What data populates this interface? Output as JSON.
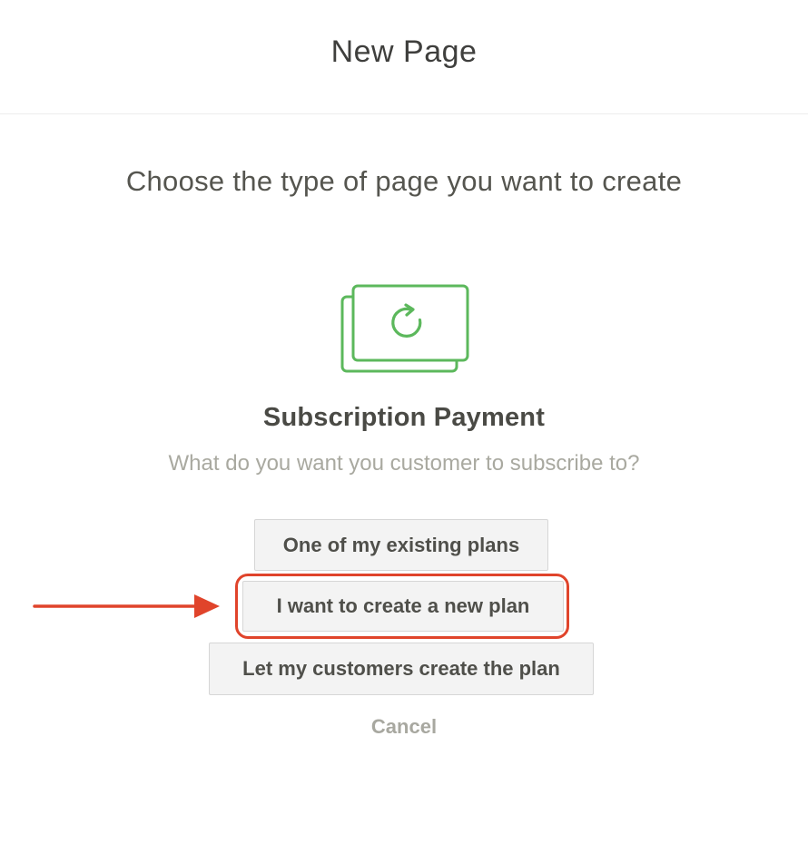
{
  "header": {
    "title": "New Page"
  },
  "main": {
    "prompt": "Choose the type of page you want to create",
    "type_title": "Subscription Payment",
    "question": "What do you want you customer to subscribe to?",
    "options": [
      {
        "label": "One of my existing plans"
      },
      {
        "label": "I want to create a new plan",
        "highlighted": true
      },
      {
        "label": "Let my customers create the plan"
      }
    ],
    "cancel_label": "Cancel",
    "illustration_icon": "subscription-cards-refresh-icon"
  },
  "colors": {
    "accent_green": "#5cb85c",
    "annotation_red": "#e0442b",
    "text_dark": "#3f3f3d",
    "text_muted": "#a9a9a0",
    "button_bg": "#f3f3f3"
  }
}
